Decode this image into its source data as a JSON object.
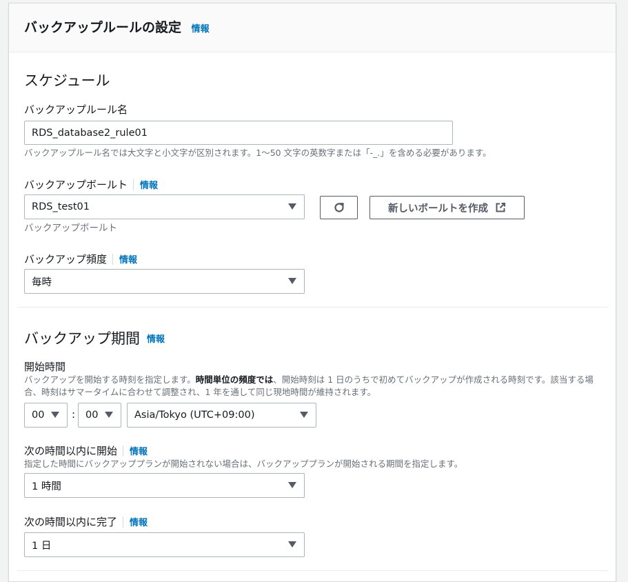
{
  "header": {
    "title": "バックアップルールの設定",
    "info": "情報"
  },
  "schedule": {
    "section_title": "スケジュール",
    "rule_name": {
      "label": "バックアップルール名",
      "value": "RDS_database2_rule01",
      "description": "バックアップルール名では大文字と小文字が区別されます。1〜50 文字の英数字または「-_.」を含める必要があります。"
    },
    "vault": {
      "label": "バックアップボールト",
      "info": "情報",
      "selected": "RDS_test01",
      "description": "バックアップボールト",
      "create_button": "新しいボールトを作成"
    },
    "frequency": {
      "label": "バックアップ頻度",
      "info": "情報",
      "selected": "毎時"
    }
  },
  "window": {
    "section_title": "バックアップ期間",
    "info": "情報",
    "start_time": {
      "label": "開始時間",
      "description_prefix": "バックアップを開始する時刻を指定します。",
      "description_bold": "時間単位の頻度では",
      "description_suffix": "、開始時刻は 1 日のうちで初めてバックアップが作成される時刻です。該当する場合、時刻はサマータイムに合わせて調整され、1 年を通して同じ現地時間が維持されます。",
      "hour": "00",
      "colon": ":",
      "minute": "00",
      "timezone": "Asia/Tokyo (UTC+09:00)"
    },
    "start_within": {
      "label": "次の時間以内に開始",
      "info": "情報",
      "description": "指定した時間にバックアッププランが開始されない場合は、バックアッププランが開始される期間を指定します。",
      "selected": "1 時間"
    },
    "complete_within": {
      "label": "次の時間以内に完了",
      "info": "情報",
      "selected": "1 日"
    }
  },
  "colors": {
    "link": "#0073bb",
    "text": "#16191f",
    "secondary_text": "#687078",
    "border": "#aab7b8",
    "header_bg": "#fafafa"
  }
}
